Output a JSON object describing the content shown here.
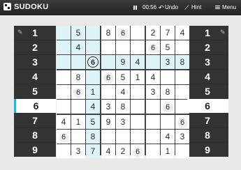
{
  "app": {
    "title": "SUDOKU"
  },
  "toolbar": {
    "timer": "00:56",
    "undo_label": "Undo",
    "hint_label": "Hint",
    "menu_label": "Menu"
  },
  "pad": {
    "numbers": [
      "1",
      "2",
      "3",
      "4",
      "5",
      "6",
      "7",
      "8",
      "9"
    ],
    "selected": "6"
  },
  "colors": {
    "accent": "#33b5c7",
    "highlight": "#dff4f6",
    "bar": "#2d2d2d"
  },
  "board": {
    "rows": [
      [
        "",
        "5",
        "",
        "8",
        "6",
        "",
        "2",
        "7",
        "4"
      ],
      [
        "",
        "4",
        "",
        "",
        "",
        "",
        "6",
        "5",
        ""
      ],
      [
        "",
        "",
        "6",
        "",
        "9",
        "4",
        "",
        "3",
        "8"
      ],
      [
        "",
        "8",
        "",
        "6",
        "5",
        "1",
        "4",
        "",
        ""
      ],
      [
        "",
        "6",
        "1",
        "",
        "4",
        "",
        "3",
        "8",
        ""
      ],
      [
        "",
        "",
        "4",
        "3",
        "8",
        "",
        "",
        "6",
        ""
      ],
      [
        "4",
        "1",
        "5",
        "9",
        "3",
        "",
        "",
        "",
        "6"
      ],
      [
        "6",
        "",
        "8",
        "",
        "",
        "",
        "",
        "4",
        "3"
      ],
      [
        "",
        "3",
        "7",
        "4",
        "2",
        "6",
        "",
        "1",
        ""
      ]
    ],
    "selected_cell": [
      2,
      2
    ]
  }
}
